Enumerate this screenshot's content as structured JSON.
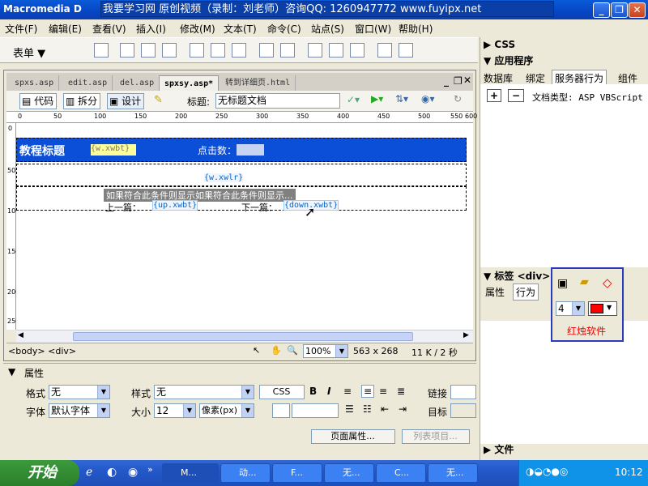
{
  "app_title": "Macromedia D",
  "banner": "我要学习网 原创视频（录制：刘老师）咨询QQ: 1260947772 www.fuyipx.net",
  "menus": [
    "文件(F)",
    "编辑(E)",
    "查看(V)",
    "插入(I)",
    "修改(M)",
    "文本(T)",
    "命令(C)",
    "站点(S)",
    "窗口(W)",
    "帮助(H)"
  ],
  "insert_label": "表单 ▼",
  "tabs": [
    "spxs.asp",
    "edit.asp",
    "del.asp",
    "spxsy.asp*",
    "转到详细页.html"
  ],
  "toolbar": {
    "code": "代码",
    "split": "拆分",
    "design": "设计",
    "title_label": "标题:",
    "title_value": "无标题文档"
  },
  "ruler_ticks": [
    "0",
    "50",
    "100",
    "150",
    "200",
    "250",
    "300",
    "350",
    "400",
    "450",
    "500",
    "550",
    "600"
  ],
  "ruler_left_ticks": [
    "0",
    "50",
    "100",
    "150",
    "200",
    "250"
  ],
  "canvas": {
    "heading": "教程标题",
    "heading_field": "{w.xwbt}",
    "clicks_label": "点击数：",
    "clicks_field": "",
    "content_field": "{w.xwlr}",
    "region_label": "如果符合此条件则显示如果符合此条件则显示...",
    "prev_label": "上一篇：",
    "prev_field": "{up.xwbt}",
    "next_label": "下一篇：",
    "next_field": "{down.xwbt}"
  },
  "status": {
    "tags": "<body> <div>",
    "zoom": "100%",
    "size": "563 x 268",
    "kb": "11 K / 2 秒"
  },
  "props": {
    "title": "属性",
    "format_label": "格式",
    "format_value": "无",
    "style_label": "样式",
    "style_value": "无",
    "css_button": "CSS",
    "font_label": "字体",
    "font_value": "默认字体",
    "size_label": "大小",
    "size_value": "12",
    "unit_value": "像素(px)",
    "link_label": "链接",
    "target_label": "目标",
    "page_props_button": "页面属性...",
    "list_button": "列表项目..."
  },
  "right": {
    "css_title": "CSS",
    "app_title": "应用程序",
    "app_tabs": [
      "数据库",
      "绑定",
      "服务器行为",
      "组件"
    ],
    "doc_type": "文档类型: ASP VBScript",
    "tag_title": "标签 <div>",
    "tag_tabs": [
      "属性",
      "行为"
    ],
    "files_title": "文件"
  },
  "popup": {
    "value": "4",
    "brand": "红烛软件"
  },
  "taskbar": {
    "start": "开始",
    "tasks": [
      "M...",
      "动...",
      "F...",
      "无...",
      "C...",
      "无..."
    ],
    "time": "10:12"
  }
}
